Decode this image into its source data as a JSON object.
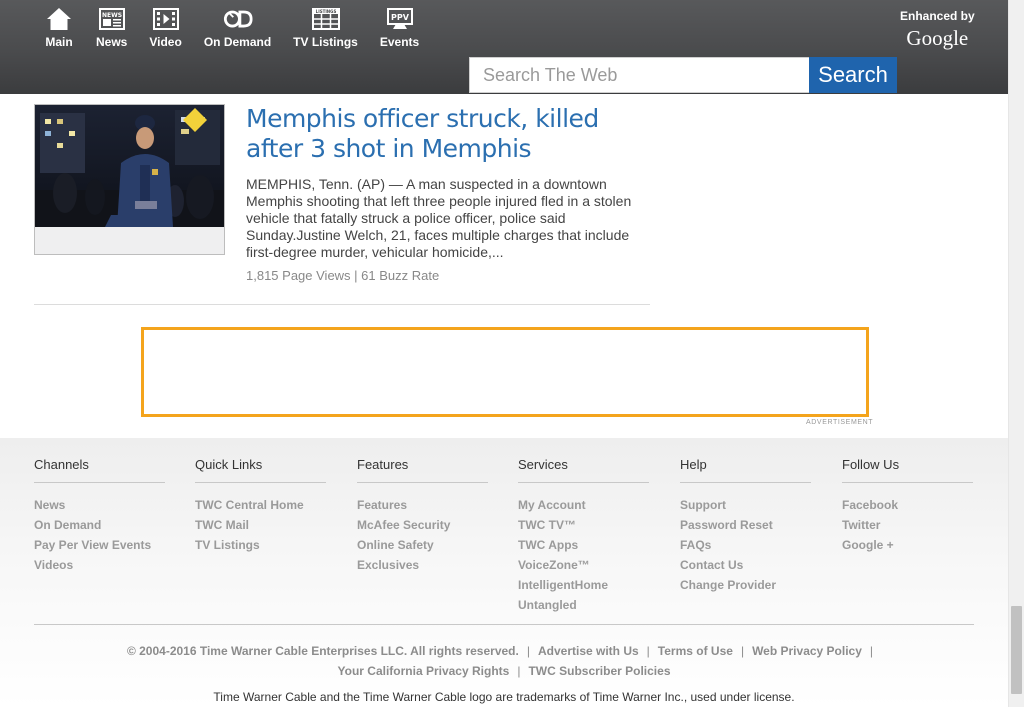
{
  "nav": {
    "items": [
      {
        "label": "Main",
        "icon": "home-icon"
      },
      {
        "label": "News",
        "icon": "news-icon"
      },
      {
        "label": "Video",
        "icon": "video-icon"
      },
      {
        "label": "On Demand",
        "icon": "on-demand-icon"
      },
      {
        "label": "TV Listings",
        "icon": "tv-listings-icon"
      },
      {
        "label": "Events",
        "icon": "ppv-events-icon"
      }
    ],
    "news_icon_text": "NEWS",
    "tv_icon_text": "LISTINGS",
    "ppv_icon_text": "PPV"
  },
  "enhanced": {
    "label": "Enhanced by",
    "logo": "Google"
  },
  "search": {
    "placeholder": "Search The Web",
    "button": "Search"
  },
  "article": {
    "title": "Memphis officer struck, killed after 3 shot in Memphis",
    "body": "MEMPHIS, Tenn. (AP) — A man suspected in a downtown Memphis shooting that left three people injured fled in a stolen vehicle that fatally struck a police officer, police said Sunday.Justine Welch, 21, faces multiple charges that include first-degree murder, vehicular homicide,...",
    "meta": "1,815 Page Views | 61 Buzz Rate"
  },
  "ad": {
    "label": "ADVERTISEMENT",
    "border_color": "#f4a41c"
  },
  "footer": {
    "columns": [
      {
        "title": "Channels",
        "links": [
          "News",
          "On Demand",
          "Pay Per View Events",
          "Videos"
        ]
      },
      {
        "title": "Quick Links",
        "links": [
          "TWC Central Home",
          "TWC Mail",
          "TV Listings"
        ]
      },
      {
        "title": "Features",
        "links": [
          "Features",
          "McAfee Security",
          "Online Safety",
          "Exclusives"
        ]
      },
      {
        "title": "Services",
        "links": [
          "My Account",
          "TWC TV™",
          "TWC Apps",
          "VoiceZone™",
          "IntelligentHome",
          "Untangled"
        ]
      },
      {
        "title": "Help",
        "links": [
          "Support",
          "Password Reset",
          "FAQs",
          "Contact Us",
          "Change Provider"
        ]
      },
      {
        "title": "Follow Us",
        "links": [
          "Facebook",
          "Twitter",
          "Google +"
        ]
      }
    ],
    "legal_row1": [
      "© 2004-2016 Time Warner Cable Enterprises LLC. All rights reserved.",
      "Advertise with Us",
      "Terms of Use",
      "Web Privacy Policy"
    ],
    "legal_row2": [
      "Your California Privacy Rights",
      "TWC Subscriber Policies"
    ],
    "trademark": "Time Warner Cable and the Time Warner Cable logo are trademarks of Time Warner Inc., used under license."
  },
  "colors": {
    "header_bg": "#4a4b4d",
    "search_button": "#1f64ad",
    "title_link": "#2b6fb0",
    "ad_border": "#f4a41c"
  }
}
